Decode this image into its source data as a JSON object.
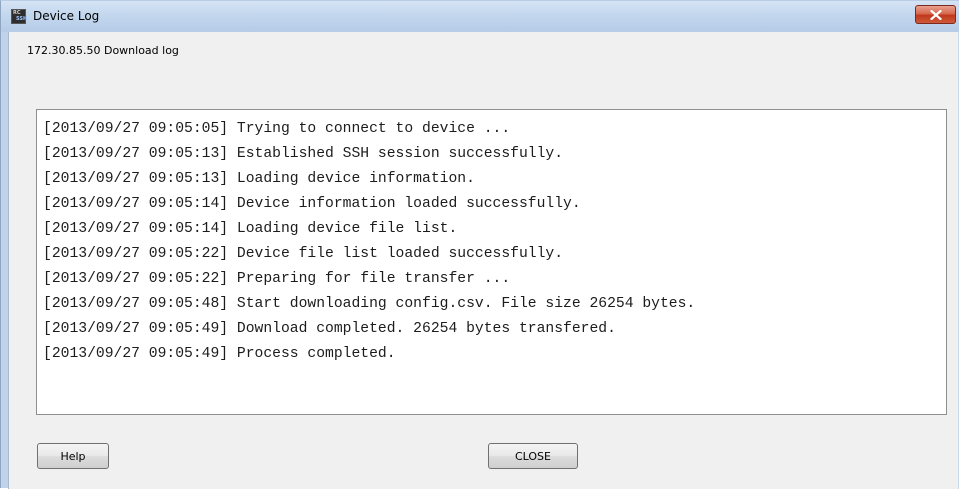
{
  "window": {
    "title": "Device Log",
    "icon": "rc-app-icon",
    "icon_text_top": "RC",
    "icon_text_bottom": "SSH"
  },
  "subtitle": "172.30.85.50 Download log",
  "log": [
    "[2013/09/27 09:05:05] Trying to connect to device ...",
    "[2013/09/27 09:05:13] Established SSH session successfully.",
    "[2013/09/27 09:05:13] Loading device information.",
    "[2013/09/27 09:05:14] Device information loaded successfully.",
    "[2013/09/27 09:05:14] Loading device file list.",
    "[2013/09/27 09:05:22] Device file list loaded successfully.",
    "[2013/09/27 09:05:22] Preparing for file transfer ...",
    "[2013/09/27 09:05:48] Start downloading config.csv. File size 26254 bytes.",
    "[2013/09/27 09:05:49] Download completed. 26254 bytes transfered.",
    "[2013/09/27 09:05:49] Process completed."
  ],
  "buttons": {
    "help": "Help",
    "close": "CLOSE"
  },
  "colors": {
    "titlebar": "#c3d7ee",
    "close_button": "#c0381c",
    "dialog_background": "#f0f0f0",
    "log_background": "#ffffff"
  }
}
